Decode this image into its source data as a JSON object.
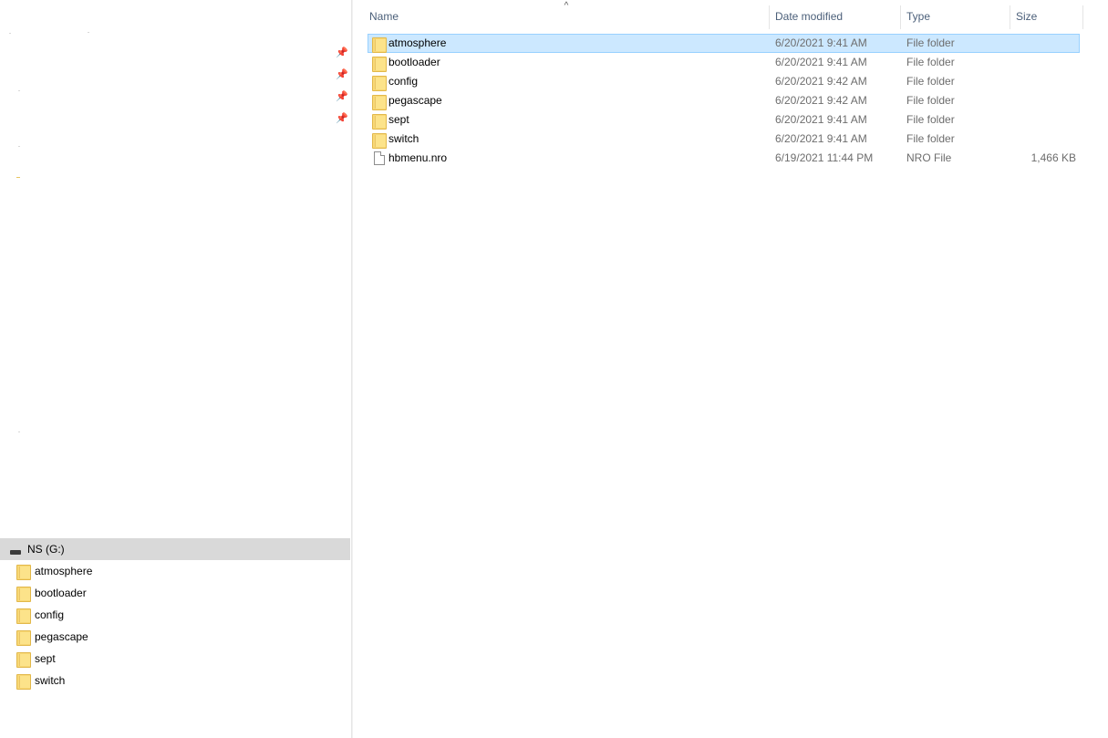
{
  "nav": {
    "quick_access_pins": [
      "pin-icon",
      "pin-icon",
      "pin-icon",
      "pin-icon"
    ],
    "drive": {
      "label": "NS (G:)",
      "icon": "drive-icon"
    },
    "folders": [
      {
        "label": "atmosphere"
      },
      {
        "label": "bootloader"
      },
      {
        "label": "config"
      },
      {
        "label": "pegascape"
      },
      {
        "label": "sept"
      },
      {
        "label": "switch"
      }
    ]
  },
  "columns": {
    "name": "Name",
    "date": "Date modified",
    "type": "Type",
    "size": "Size",
    "sort_indicator": "^"
  },
  "files": [
    {
      "name": "atmosphere",
      "date": "6/20/2021 9:41 AM",
      "type": "File folder",
      "size": "",
      "icon": "folder-icon",
      "selected": true
    },
    {
      "name": "bootloader",
      "date": "6/20/2021 9:41 AM",
      "type": "File folder",
      "size": "",
      "icon": "folder-icon"
    },
    {
      "name": "config",
      "date": "6/20/2021 9:42 AM",
      "type": "File folder",
      "size": "",
      "icon": "folder-icon"
    },
    {
      "name": "pegascape",
      "date": "6/20/2021 9:42 AM",
      "type": "File folder",
      "size": "",
      "icon": "folder-icon"
    },
    {
      "name": "sept",
      "date": "6/20/2021 9:41 AM",
      "type": "File folder",
      "size": "",
      "icon": "folder-icon"
    },
    {
      "name": "switch",
      "date": "6/20/2021 9:41 AM",
      "type": "File folder",
      "size": "",
      "icon": "folder-icon"
    },
    {
      "name": "hbmenu.nro",
      "date": "6/19/2021 11:44 PM",
      "type": "NRO File",
      "size": "1,466 KB",
      "icon": "file-icon"
    }
  ],
  "colors": {
    "selection_bg": "#cce8ff",
    "selection_border": "#99d1ff",
    "drive_row_bg": "#d9d9d9",
    "header_text": "#4c607a"
  }
}
